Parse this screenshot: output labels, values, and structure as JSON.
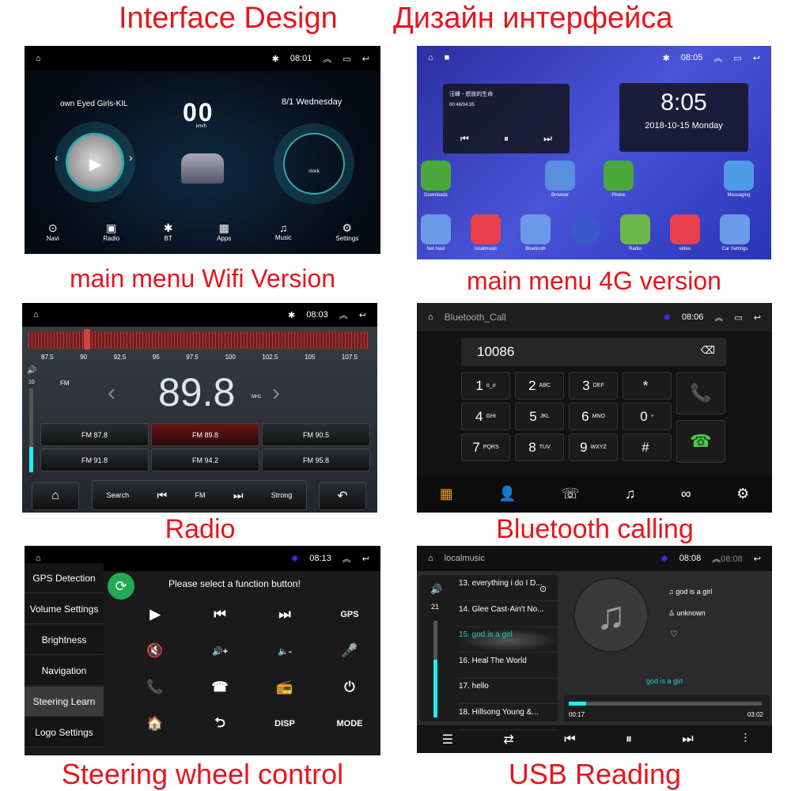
{
  "captions": {
    "title_en": "Interface Design",
    "title_ru": "Дизайн интерфейса",
    "p1": "main menu Wifi Version",
    "p2": "main menu 4G version",
    "p3": "Radio",
    "p4": "Bluetooth calling",
    "p5": "Steering wheel control",
    "p6": "USB Reading"
  },
  "colors": {
    "caption": "#e8141c",
    "accent": "#22d3e0"
  },
  "wifi": {
    "time": "08:01",
    "song": "own Eyed Girls-KIL",
    "speed": "00",
    "speed_unit": "km/h",
    "date": "8/1 Wednesday",
    "clock_label": "clock",
    "nav": [
      {
        "label": "Navi",
        "icon": "map-pin-icon"
      },
      {
        "label": "Radio",
        "icon": "radio-icon"
      },
      {
        "label": "BT",
        "icon": "bluetooth-icon"
      },
      {
        "label": "Apps",
        "icon": "apps-grid-icon"
      },
      {
        "label": "Music",
        "icon": "music-icon"
      },
      {
        "label": "Settings",
        "icon": "gear-icon"
      }
    ]
  },
  "g4": {
    "time": "08:05",
    "song": "汪峰 - 怒放的生命",
    "progress": "00:46/04:35",
    "clock": "8:05",
    "date": "2018-10-15  Monday",
    "apps_row1": [
      {
        "label": "Downloads",
        "color": "#4aa83a"
      },
      {
        "label": "Browser",
        "color": "#5a8fe0"
      },
      {
        "label": "Phone",
        "color": "#4aa83a"
      },
      {
        "label": "Messaging",
        "color": "#4f9be8"
      }
    ],
    "apps_row2": [
      {
        "label": "Net Navi",
        "color": "#6a9ae8"
      },
      {
        "label": "localmusic",
        "color": "#e8404a"
      },
      {
        "label": "Bluetooth",
        "color": "#6a9ae8"
      },
      {
        "label": "",
        "color": "#3a58c8"
      },
      {
        "label": "Radio",
        "color": "#6ab84a"
      },
      {
        "label": "video",
        "color": "#e8404a"
      },
      {
        "label": "Car Settings",
        "color": "#6a9ae8"
      }
    ]
  },
  "radio": {
    "time": "08:03",
    "scale": [
      "87.5",
      "90",
      "92.5",
      "95",
      "97.5",
      "100",
      "102.5",
      "105",
      "107.5"
    ],
    "volume": "10",
    "band": "FM",
    "freq": "89.8",
    "unit": "MHz",
    "presets": [
      "FM 87.8",
      "FM 89.8",
      "FM 90.5",
      "FM 91.8",
      "FM 94.2",
      "FM 95.8"
    ],
    "selected_preset": 1,
    "volume_level": 0.3,
    "bar": {
      "search": "Search",
      "fm": "FM",
      "strong": "Strong"
    }
  },
  "bt": {
    "title": "Bluetooth_Call",
    "time": "08:06",
    "number": "10086",
    "keys": [
      {
        "d": "1",
        "s": "o_o"
      },
      {
        "d": "2",
        "s": "ABC"
      },
      {
        "d": "3",
        "s": "DEF"
      },
      {
        "d": "*",
        "s": ""
      },
      {
        "d": "4",
        "s": "GHI"
      },
      {
        "d": "5",
        "s": "JKL"
      },
      {
        "d": "6",
        "s": "MNO"
      },
      {
        "d": "0",
        "s": "+"
      },
      {
        "d": "7",
        "s": "PQRS"
      },
      {
        "d": "8",
        "s": "TUV"
      },
      {
        "d": "9",
        "s": "WXYZ"
      },
      {
        "d": "#",
        "s": ""
      }
    ]
  },
  "steer": {
    "time": "08:13",
    "prompt": "Please select a function button!",
    "menu": [
      "GPS Detection",
      "Volume Settings",
      "Brightness",
      "Navigation",
      "Steering Learn",
      "Logo Settings"
    ],
    "selected": 4,
    "functions": [
      "▶",
      "⏮",
      "⏭",
      "GPS",
      "🔇",
      "🔊+",
      "🔈-",
      "🎤",
      "📞",
      "☎",
      "📻",
      "⏻",
      "🏠",
      "⮌",
      "DISP",
      "MODE"
    ]
  },
  "usb": {
    "title": "localmusic",
    "time": "08:08",
    "ghost_time": "08:08",
    "volume": "21",
    "volume_level": 0.6,
    "songs": [
      "13. everything i do I D...",
      "14. Glee Cast-Ain't No...",
      "15. god is a girl",
      "16. Heal The World",
      "17. hello",
      "18. Hillsong Young &..."
    ],
    "selected": 2,
    "track": "god is a girl",
    "artist": "unknown",
    "lyric": "god is a girl",
    "elapsed": "00:17",
    "total": "03:02",
    "progress": 0.09
  }
}
